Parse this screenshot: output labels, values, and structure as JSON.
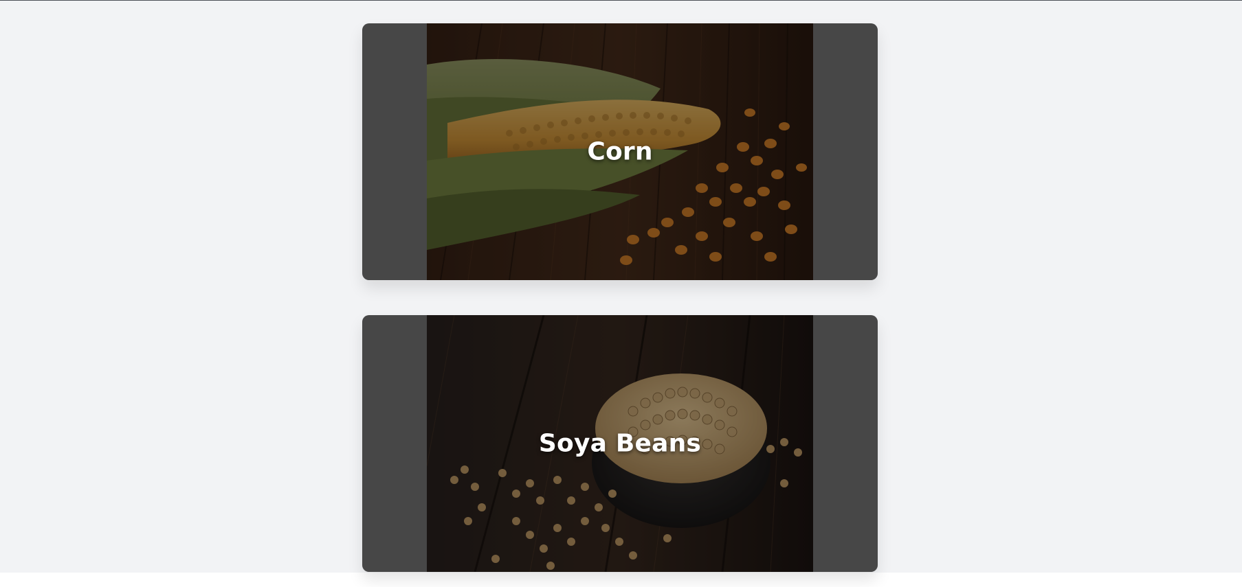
{
  "colors": {
    "page_background": "#f2f3f5",
    "card_background": "#7a7a7a",
    "title_color": "#ffffff",
    "top_rule": "#4b4f55"
  },
  "cards": [
    {
      "title": "Corn",
      "image": "corn-cob-and-kernels-on-dark-wood-photo"
    },
    {
      "title": "Soya Beans",
      "image": "bowl-of-soya-beans-on-dark-wood-photo"
    }
  ]
}
